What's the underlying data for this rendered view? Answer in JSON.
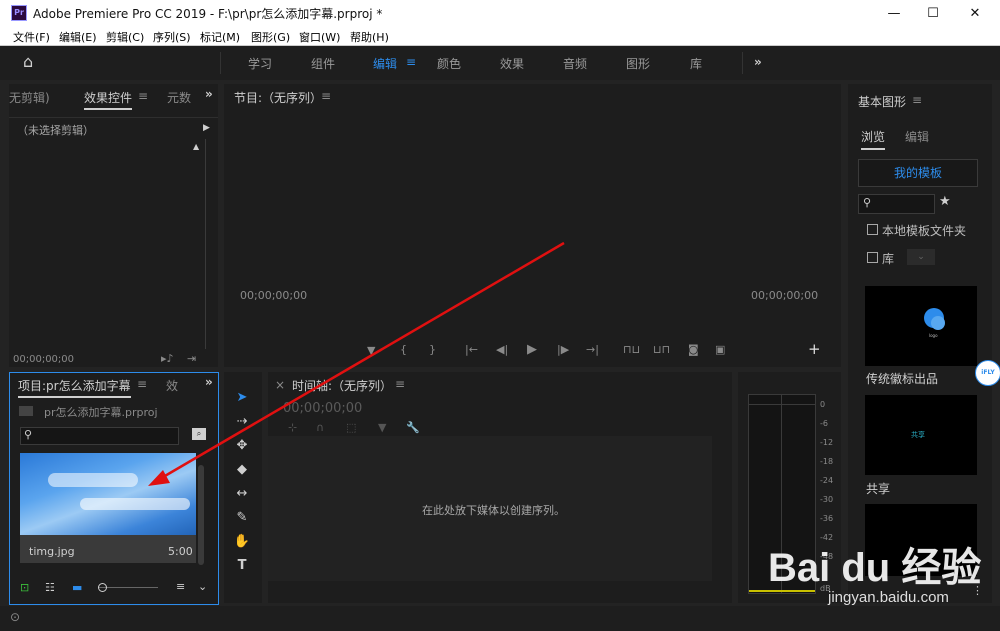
{
  "window": {
    "app_icon": "Pr",
    "title": "Adobe Premiere Pro CC 2019 - F:\\pr\\pr怎么添加字幕.prproj *",
    "minimize": "—",
    "maximize": "☐",
    "close": "✕"
  },
  "menu": [
    "文件(F)",
    "编辑(E)",
    "剪辑(C)",
    "序列(S)",
    "标记(M)",
    "图形(G)",
    "窗口(W)",
    "帮助(H)"
  ],
  "workspaces": {
    "home": "⌂",
    "tabs": [
      "学习",
      "组件",
      "编辑",
      "颜色",
      "效果",
      "音频",
      "图形",
      "库"
    ],
    "active": "编辑",
    "more": "»"
  },
  "source_panel": {
    "tab_no_clip": "无剪辑)",
    "tab_effect_controls": "效果控件",
    "tab_metadata": "元数",
    "no_clip_selected": "（未选择剪辑）",
    "timecode": "00;00;00;00"
  },
  "program_monitor": {
    "title": "节目:（无序列）",
    "timecode_left": "00;00;00;00",
    "timecode_right": "00;00;00;00",
    "add_button": "+"
  },
  "project_panel": {
    "tab_title": "项目:pr怎么添加字幕",
    "tab_next": "效",
    "project_file": "pr怎么添加字幕.prproj",
    "clip_name": "timg.jpg",
    "clip_duration": "5:00"
  },
  "timeline": {
    "title": "时间轴:（无序列）",
    "close": "×",
    "timecode": "00;00;00;00",
    "empty_message": "在此处放下媒体以创建序列。"
  },
  "audio_meter": {
    "labels": [
      "0",
      "-6",
      "-12",
      "-18",
      "-24",
      "-30",
      "-36",
      "-42",
      "-48",
      "dB"
    ]
  },
  "essential_graphics": {
    "title": "基本图形",
    "tab_browse": "浏览",
    "tab_edit": "编辑",
    "my_templates": "我的模板",
    "local_templates": "本地模板文件夹",
    "library": "库",
    "templates": [
      {
        "name": "传统徽标出品",
        "preview_text": "logo"
      },
      {
        "name": "共享",
        "preview_text": "共享"
      }
    ]
  },
  "watermark": {
    "brand": "Bai du 经验",
    "url": "jingyan.baidu.com"
  },
  "ifly_badge": "iFLY",
  "colors": {
    "accent": "#2d8ceb",
    "panel_bg": "#1d1d1d",
    "frame_bg": "#232323",
    "arrow": "#e01010"
  }
}
